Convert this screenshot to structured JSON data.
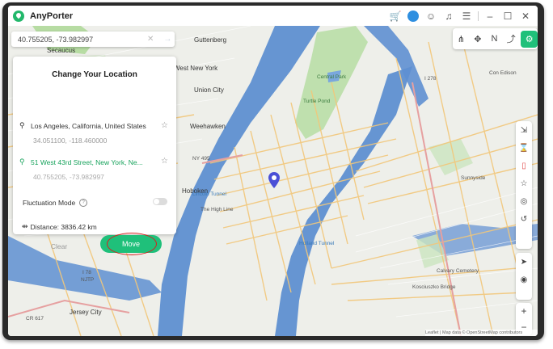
{
  "app": {
    "title": "AnyPorter"
  },
  "titlebar_icons": [
    "cart-icon",
    "user-avatar",
    "discord-icon",
    "headset-icon",
    "menu-icon",
    "minimize-icon",
    "maximize-icon",
    "close-icon"
  ],
  "search": {
    "value": "40.755205, -73.982997"
  },
  "panel": {
    "title": "Change Your Location",
    "from": {
      "name": "Los Angeles, California, United States",
      "coords": "34.051100, -118.460000"
    },
    "to": {
      "name": "51 West 43rd Street, New York, Ne...",
      "coords": "40.755205, -73.982997"
    },
    "fluctuation_label": "Fluctuation Mode",
    "fluctuation_on": false,
    "distance_label": "Distance: 3836.42 km",
    "clear_label": "Clear",
    "move_label": "Move"
  },
  "colors": {
    "accent": "#1fc07a",
    "highlight": "#d61f1f",
    "water": "#5e8fd1",
    "park": "#bfe0ae"
  },
  "map_labels": {
    "guttenberg": "Guttenberg",
    "secaucus": "Secaucus",
    "west_new_york": "West New York",
    "weehawken": "Weehawken",
    "union_city": "Union City",
    "jersey_city": "Jersey City",
    "hoboken": "Hoboken",
    "central_park": "Central Park",
    "turtle_pond": "Turtle Pond",
    "lincoln_tunnel": "Lincoln Tunnel",
    "holland_tunnel": "Holland Tunnel",
    "the_high_line": "The High Line",
    "kosciuszko_bridge": "Kosciuszko Bridge",
    "con_edison": "Con Edison",
    "cr_617": "CR 617",
    "i_278": "I 278",
    "ny_495": "NY 495",
    "i_78": "I 78",
    "njtp": "NJTP",
    "sunnyside": "Sunnyside",
    "calvary_cemetery": "Calvary Cemetery"
  },
  "attribution": "Leaflet | Map data © OpenStreetMap contributors"
}
